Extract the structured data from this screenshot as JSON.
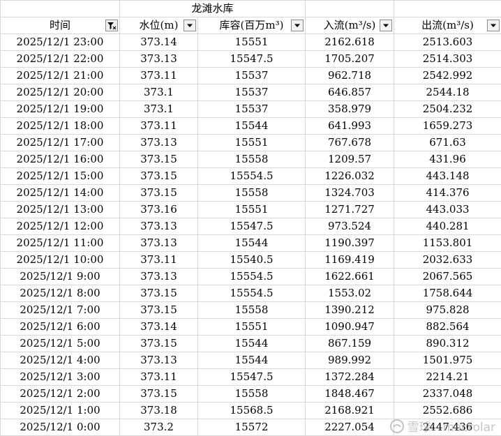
{
  "title": "龙滩水库",
  "headers": {
    "time": "时间",
    "level": "水位(m)",
    "storage": "库容(百万m³)",
    "inflow": "入流(m³/s)",
    "outflow": "出流(m³/s)"
  },
  "rows": [
    {
      "time": "2025/12/1 23:00",
      "level": "373.14",
      "storage": "15551",
      "inflow": "2162.618",
      "outflow": "2513.603"
    },
    {
      "time": "2025/12/1 22:00",
      "level": "373.13",
      "storage": "15547.5",
      "inflow": "1705.207",
      "outflow": "2514.303"
    },
    {
      "time": "2025/12/1 21:00",
      "level": "373.11",
      "storage": "15537",
      "inflow": "962.718",
      "outflow": "2542.992"
    },
    {
      "time": "2025/12/1 20:00",
      "level": "373.1",
      "storage": "15537",
      "inflow": "646.857",
      "outflow": "2544.18"
    },
    {
      "time": "2025/12/1 19:00",
      "level": "373.1",
      "storage": "15537",
      "inflow": "358.979",
      "outflow": "2504.232"
    },
    {
      "time": "2025/12/1 18:00",
      "level": "373.11",
      "storage": "15544",
      "inflow": "641.993",
      "outflow": "1659.273"
    },
    {
      "time": "2025/12/1 17:00",
      "level": "373.13",
      "storage": "15551",
      "inflow": "767.678",
      "outflow": "671.63"
    },
    {
      "time": "2025/12/1 16:00",
      "level": "373.15",
      "storage": "15558",
      "inflow": "1209.57",
      "outflow": "431.96"
    },
    {
      "time": "2025/12/1 15:00",
      "level": "373.15",
      "storage": "15554.5",
      "inflow": "1226.032",
      "outflow": "443.148"
    },
    {
      "time": "2025/12/1 14:00",
      "level": "373.15",
      "storage": "15558",
      "inflow": "1324.703",
      "outflow": "414.376"
    },
    {
      "time": "2025/12/1 13:00",
      "level": "373.16",
      "storage": "15551",
      "inflow": "1271.727",
      "outflow": "443.033"
    },
    {
      "time": "2025/12/1 12:00",
      "level": "373.13",
      "storage": "15547.5",
      "inflow": "973.524",
      "outflow": "440.281"
    },
    {
      "time": "2025/12/1 11:00",
      "level": "373.13",
      "storage": "15544",
      "inflow": "1190.397",
      "outflow": "1153.801"
    },
    {
      "time": "2025/12/1 10:00",
      "level": "373.11",
      "storage": "15540.5",
      "inflow": "1169.419",
      "outflow": "2032.633"
    },
    {
      "time": "2025/12/1 9:00",
      "level": "373.13",
      "storage": "15554.5",
      "inflow": "1622.661",
      "outflow": "2067.565"
    },
    {
      "time": "2025/12/1 8:00",
      "level": "373.15",
      "storage": "15554.5",
      "inflow": "1553.02",
      "outflow": "1758.644"
    },
    {
      "time": "2025/12/1 7:00",
      "level": "373.15",
      "storage": "15558",
      "inflow": "1390.212",
      "outflow": "975.828"
    },
    {
      "time": "2025/12/1 6:00",
      "level": "373.14",
      "storage": "15551",
      "inflow": "1090.947",
      "outflow": "882.564"
    },
    {
      "time": "2025/12/1 5:00",
      "level": "373.15",
      "storage": "15544",
      "inflow": "867.159",
      "outflow": "890.312"
    },
    {
      "time": "2025/12/1 4:00",
      "level": "373.13",
      "storage": "15544",
      "inflow": "989.992",
      "outflow": "1501.975"
    },
    {
      "time": "2025/12/1 3:00",
      "level": "373.11",
      "storage": "15547.5",
      "inflow": "1372.284",
      "outflow": "2214.21"
    },
    {
      "time": "2025/12/1 2:00",
      "level": "373.15",
      "storage": "15558",
      "inflow": "1848.467",
      "outflow": "2337.048"
    },
    {
      "time": "2025/12/1 1:00",
      "level": "373.18",
      "storage": "15568.5",
      "inflow": "2168.921",
      "outflow": "2552.686"
    },
    {
      "time": "2025/12/1 0:00",
      "level": "373.2",
      "storage": "15572",
      "inflow": "2227.054",
      "outflow": "2447.436"
    }
  ],
  "watermark": {
    "text": "雪球：macrolar",
    "icon": "snowball-logo-icon"
  },
  "colors": {
    "grid": "#d9d9d9",
    "text": "#000000",
    "watermark": "#969696"
  }
}
